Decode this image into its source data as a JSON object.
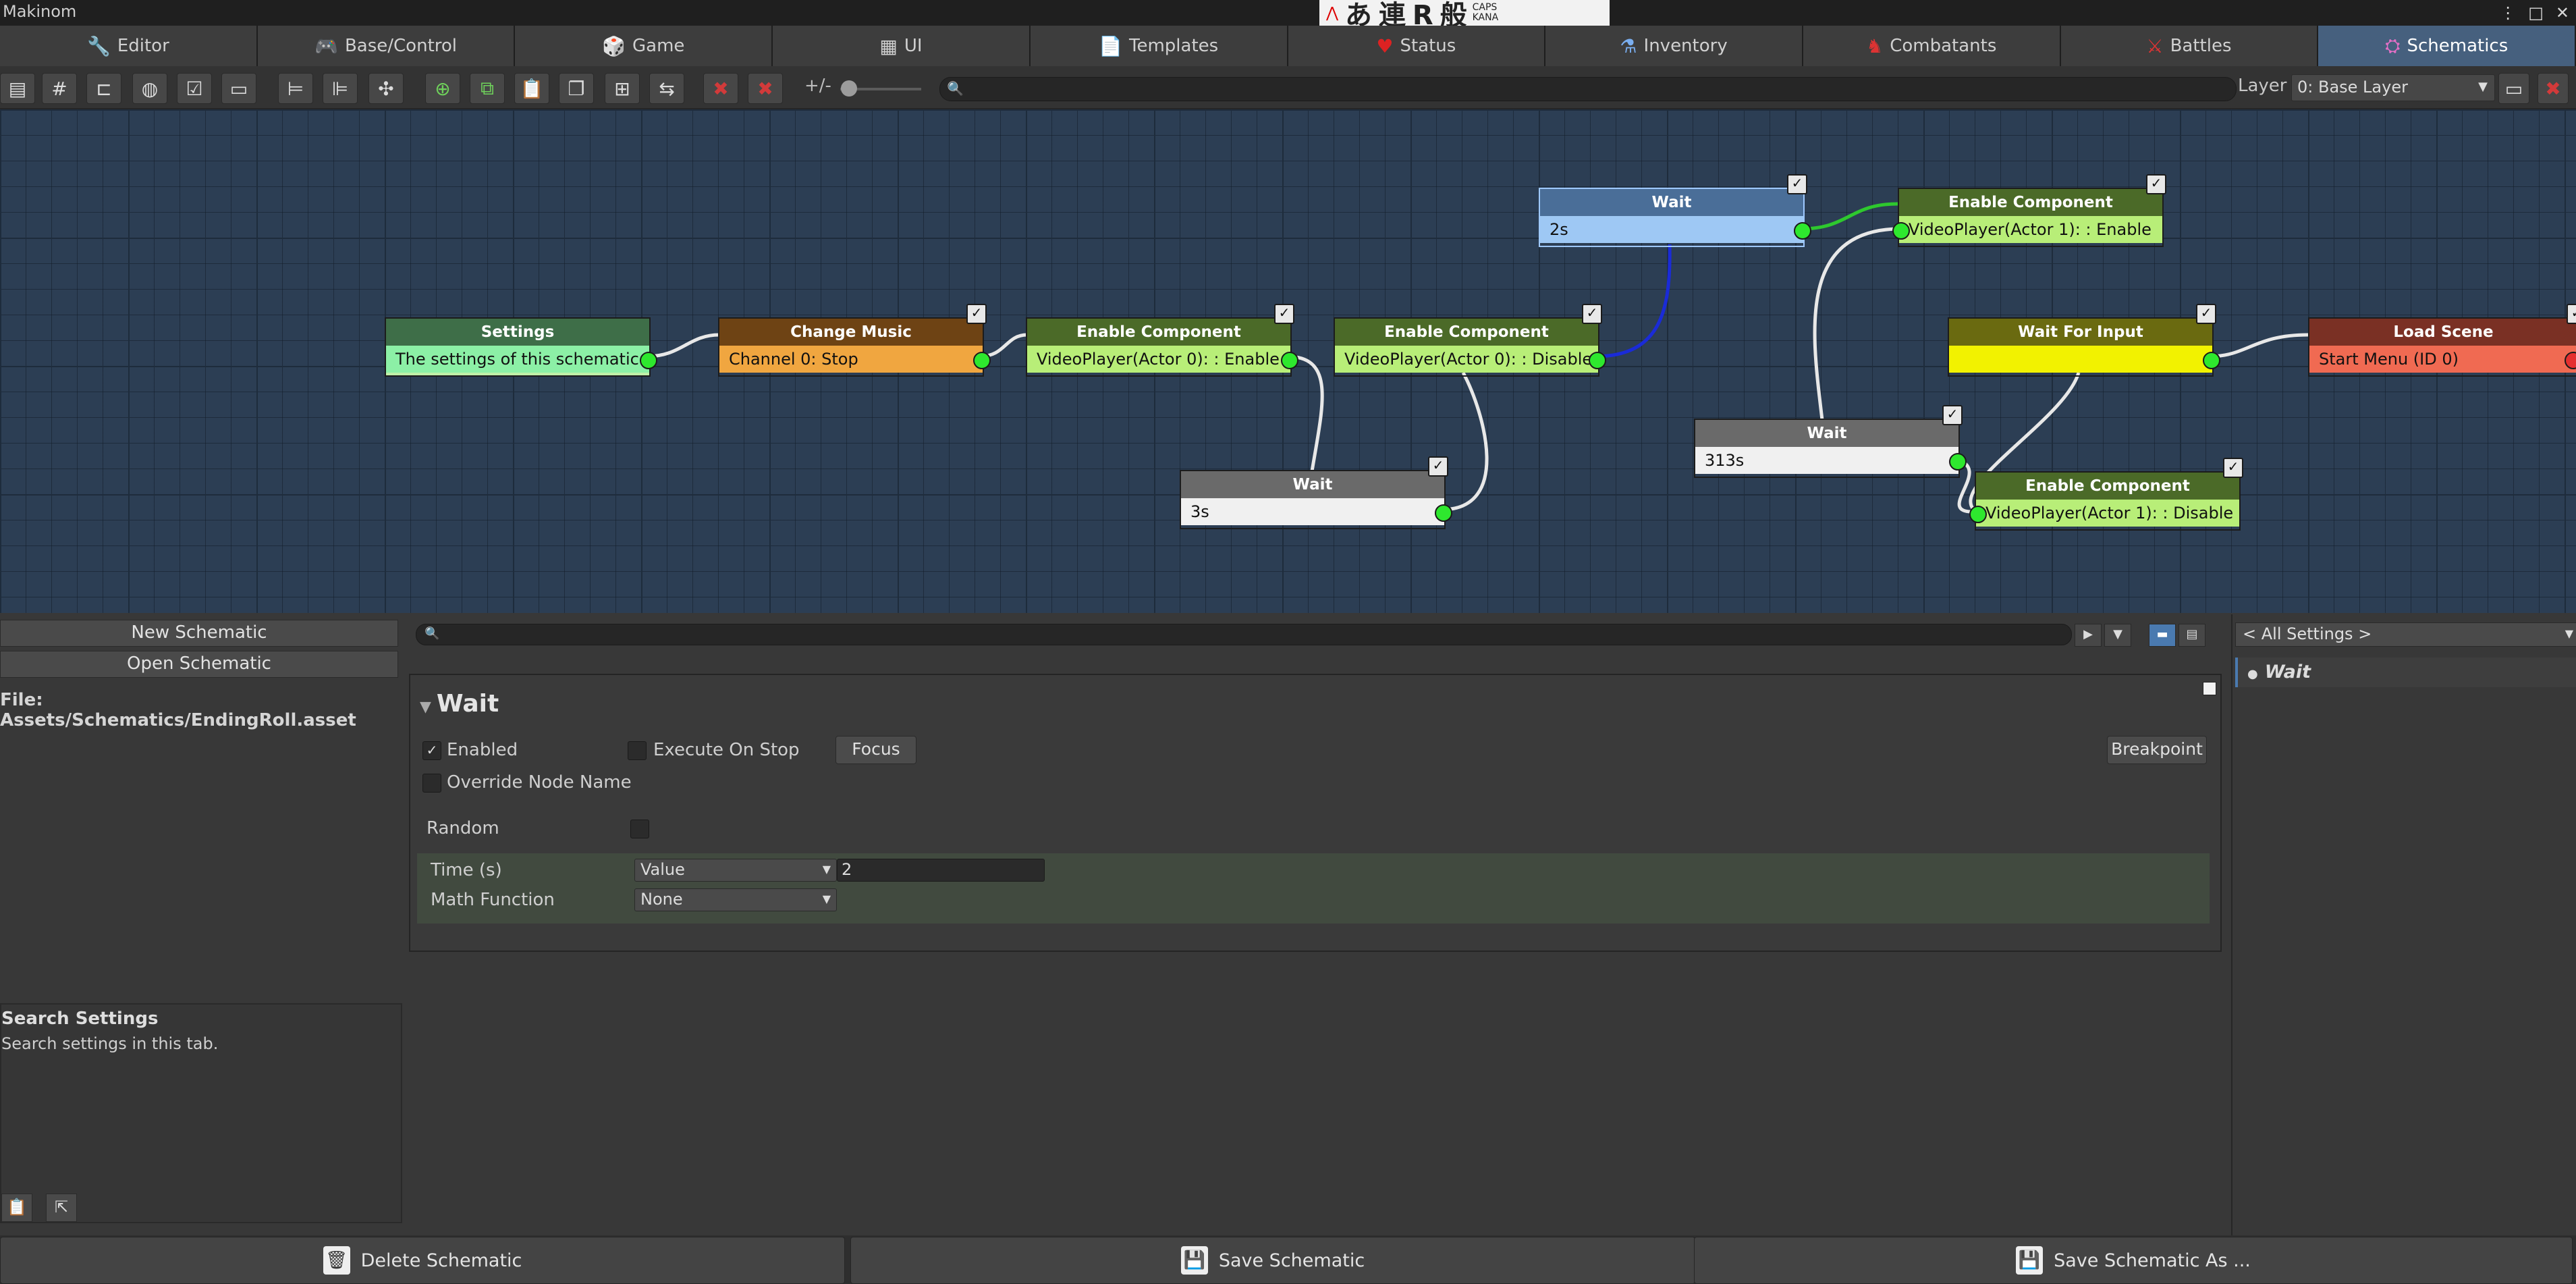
{
  "window": {
    "title": "Makinom"
  },
  "ime": {
    "glyphs": "あ 連 R 般",
    "caps": "CAPS KANA"
  },
  "tabs": [
    {
      "label": "Editor",
      "icon": "wrench-icon",
      "glyph": "🔧"
    },
    {
      "label": "Base/Control",
      "icon": "gamepad-icon",
      "glyph": "🎮"
    },
    {
      "label": "Game",
      "icon": "cube-icon",
      "glyph": "🎲"
    },
    {
      "label": "UI",
      "icon": "ui-icon",
      "glyph": "▦"
    },
    {
      "label": "Templates",
      "icon": "document-icon",
      "glyph": "📄"
    },
    {
      "label": "Status",
      "icon": "heart-icon",
      "glyph": "♥"
    },
    {
      "label": "Inventory",
      "icon": "potion-icon",
      "glyph": "⚗"
    },
    {
      "label": "Combatants",
      "icon": "combatant-icon",
      "glyph": "♞"
    },
    {
      "label": "Battles",
      "icon": "swords-icon",
      "glyph": "⚔"
    },
    {
      "label": "Schematics",
      "icon": "schematic-icon",
      "glyph": "⛭",
      "active": true
    }
  ],
  "toolbar": {
    "zoom_label": "+/-",
    "search_placeholder": "🔍",
    "layer_label": "Layer",
    "layer_value": "0: Base Layer"
  },
  "nodes": {
    "settings": {
      "title": "Settings",
      "body": "The settings of this schematic"
    },
    "change_music": {
      "title": "Change Music",
      "body": "Channel 0: Stop"
    },
    "enable1": {
      "title": "Enable Component",
      "body": "VideoPlayer(Actor 0): : Enable"
    },
    "enable2": {
      "title": "Enable Component",
      "body": "VideoPlayer(Actor 0): : Disable"
    },
    "wait3s": {
      "title": "Wait",
      "body": "3s"
    },
    "wait2s": {
      "title": "Wait",
      "body": "2s"
    },
    "enable3": {
      "title": "Enable Component",
      "body": "VideoPlayer(Actor 1): : Enable"
    },
    "wait313": {
      "title": "Wait",
      "body": "313s"
    },
    "wait_input": {
      "title": "Wait For Input",
      "body": ""
    },
    "enable4": {
      "title": "Enable Component",
      "body": "VideoPlayer(Actor 1): : Disable"
    },
    "load_scene": {
      "title": "Load Scene",
      "body": "Start Menu (ID 0)"
    },
    "check": "✓"
  },
  "left": {
    "new_schematic": "New Schematic",
    "open_schematic": "Open Schematic",
    "file_label": "File:",
    "file_path": "Assets/Schematics/EndingRoll.asset",
    "search_title": "Search Settings",
    "search_desc": "Search settings in this tab."
  },
  "inspector": {
    "title": "Wait",
    "enabled_label": "Enabled",
    "execute_on_stop_label": "Execute On Stop",
    "focus_label": "Focus",
    "override_label": "Override Node Name",
    "breakpoint_label": "Breakpoint",
    "random_label": "Random",
    "time_label": "Time (s)",
    "time_type": "Value",
    "time_value": "2",
    "math_label": "Math Function",
    "math_value": "None"
  },
  "right": {
    "filter": "< All Settings >",
    "item": "Wait"
  },
  "bottom": {
    "delete": "Delete Schematic",
    "save": "Save Schematic",
    "save_as": "Save Schematic As ..."
  },
  "colors": {
    "canvas": "#2c3e54",
    "active_tab": "#46607e",
    "port": "#2ee82e",
    "wire_white": "#e8e8e8",
    "wire_green": "#2ec82e",
    "wire_blue": "#1a2bd8"
  }
}
